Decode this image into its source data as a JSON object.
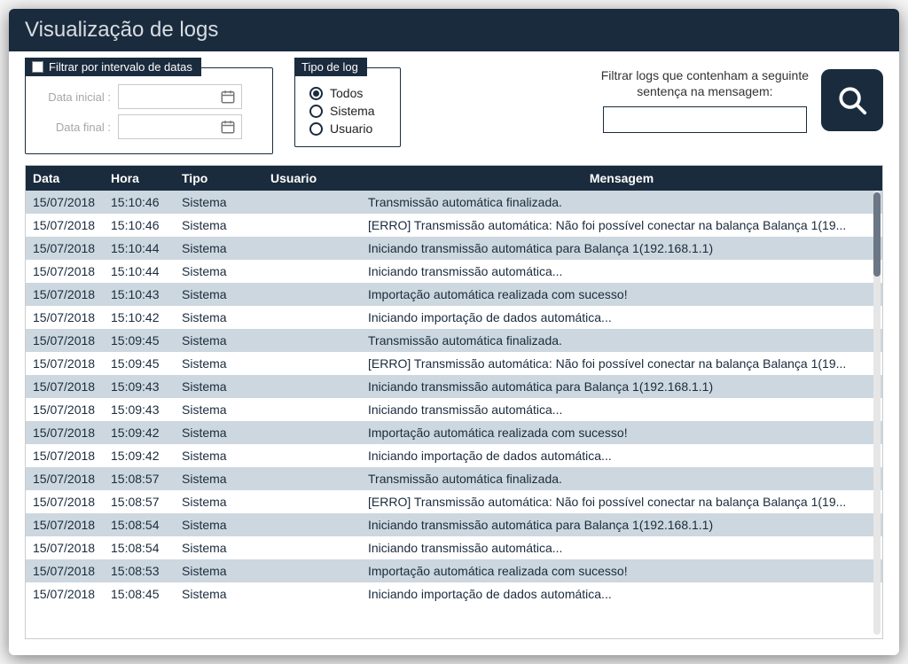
{
  "title": "Visualização de logs",
  "dateFilter": {
    "legend": "Filtrar por intervalo de datas",
    "startLabel": "Data inicial :",
    "endLabel": "Data final :"
  },
  "typeFilter": {
    "legend": "Tipo de log",
    "options": [
      "Todos",
      "Sistema",
      "Usuario"
    ],
    "selected": "Todos"
  },
  "msgFilter": {
    "label1": "Filtrar logs que contenham a seguinte",
    "label2": "sentença na mensagem:"
  },
  "columns": {
    "data": "Data",
    "hora": "Hora",
    "tipo": "Tipo",
    "usuario": "Usuario",
    "mensagem": "Mensagem"
  },
  "rows": [
    {
      "data": "15/07/2018",
      "hora": "15:10:46",
      "tipo": "Sistema",
      "usuario": "",
      "mensagem": "Transmissão automática finalizada."
    },
    {
      "data": "15/07/2018",
      "hora": "15:10:46",
      "tipo": "Sistema",
      "usuario": "",
      "mensagem": "[ERRO] Transmissão automática: Não foi possível conectar na balança Balança 1(19..."
    },
    {
      "data": "15/07/2018",
      "hora": "15:10:44",
      "tipo": "Sistema",
      "usuario": "",
      "mensagem": "Iniciando transmissão automática para Balança 1(192.168.1.1)"
    },
    {
      "data": "15/07/2018",
      "hora": "15:10:44",
      "tipo": "Sistema",
      "usuario": "",
      "mensagem": "Iniciando transmissão automática..."
    },
    {
      "data": "15/07/2018",
      "hora": "15:10:43",
      "tipo": "Sistema",
      "usuario": "",
      "mensagem": "Importação automática realizada com sucesso!"
    },
    {
      "data": "15/07/2018",
      "hora": "15:10:42",
      "tipo": "Sistema",
      "usuario": "",
      "mensagem": "Iniciando importação de dados automática..."
    },
    {
      "data": "15/07/2018",
      "hora": "15:09:45",
      "tipo": "Sistema",
      "usuario": "",
      "mensagem": "Transmissão automática finalizada."
    },
    {
      "data": "15/07/2018",
      "hora": "15:09:45",
      "tipo": "Sistema",
      "usuario": "",
      "mensagem": "[ERRO] Transmissão automática: Não foi possível conectar na balança Balança 1(19..."
    },
    {
      "data": "15/07/2018",
      "hora": "15:09:43",
      "tipo": "Sistema",
      "usuario": "",
      "mensagem": "Iniciando transmissão automática para Balança 1(192.168.1.1)"
    },
    {
      "data": "15/07/2018",
      "hora": "15:09:43",
      "tipo": "Sistema",
      "usuario": "",
      "mensagem": "Iniciando transmissão automática..."
    },
    {
      "data": "15/07/2018",
      "hora": "15:09:42",
      "tipo": "Sistema",
      "usuario": "",
      "mensagem": "Importação automática realizada com sucesso!"
    },
    {
      "data": "15/07/2018",
      "hora": "15:09:42",
      "tipo": "Sistema",
      "usuario": "",
      "mensagem": "Iniciando importação de dados automática..."
    },
    {
      "data": "15/07/2018",
      "hora": "15:08:57",
      "tipo": "Sistema",
      "usuario": "",
      "mensagem": "Transmissão automática finalizada."
    },
    {
      "data": "15/07/2018",
      "hora": "15:08:57",
      "tipo": "Sistema",
      "usuario": "",
      "mensagem": "[ERRO] Transmissão automática: Não foi possível conectar na balança Balança 1(19..."
    },
    {
      "data": "15/07/2018",
      "hora": "15:08:54",
      "tipo": "Sistema",
      "usuario": "",
      "mensagem": "Iniciando transmissão automática para Balança 1(192.168.1.1)"
    },
    {
      "data": "15/07/2018",
      "hora": "15:08:54",
      "tipo": "Sistema",
      "usuario": "",
      "mensagem": "Iniciando transmissão automática..."
    },
    {
      "data": "15/07/2018",
      "hora": "15:08:53",
      "tipo": "Sistema",
      "usuario": "",
      "mensagem": "Importação automática realizada com sucesso!"
    },
    {
      "data": "15/07/2018",
      "hora": "15:08:45",
      "tipo": "Sistema",
      "usuario": "",
      "mensagem": "Iniciando importação de dados automática..."
    }
  ]
}
